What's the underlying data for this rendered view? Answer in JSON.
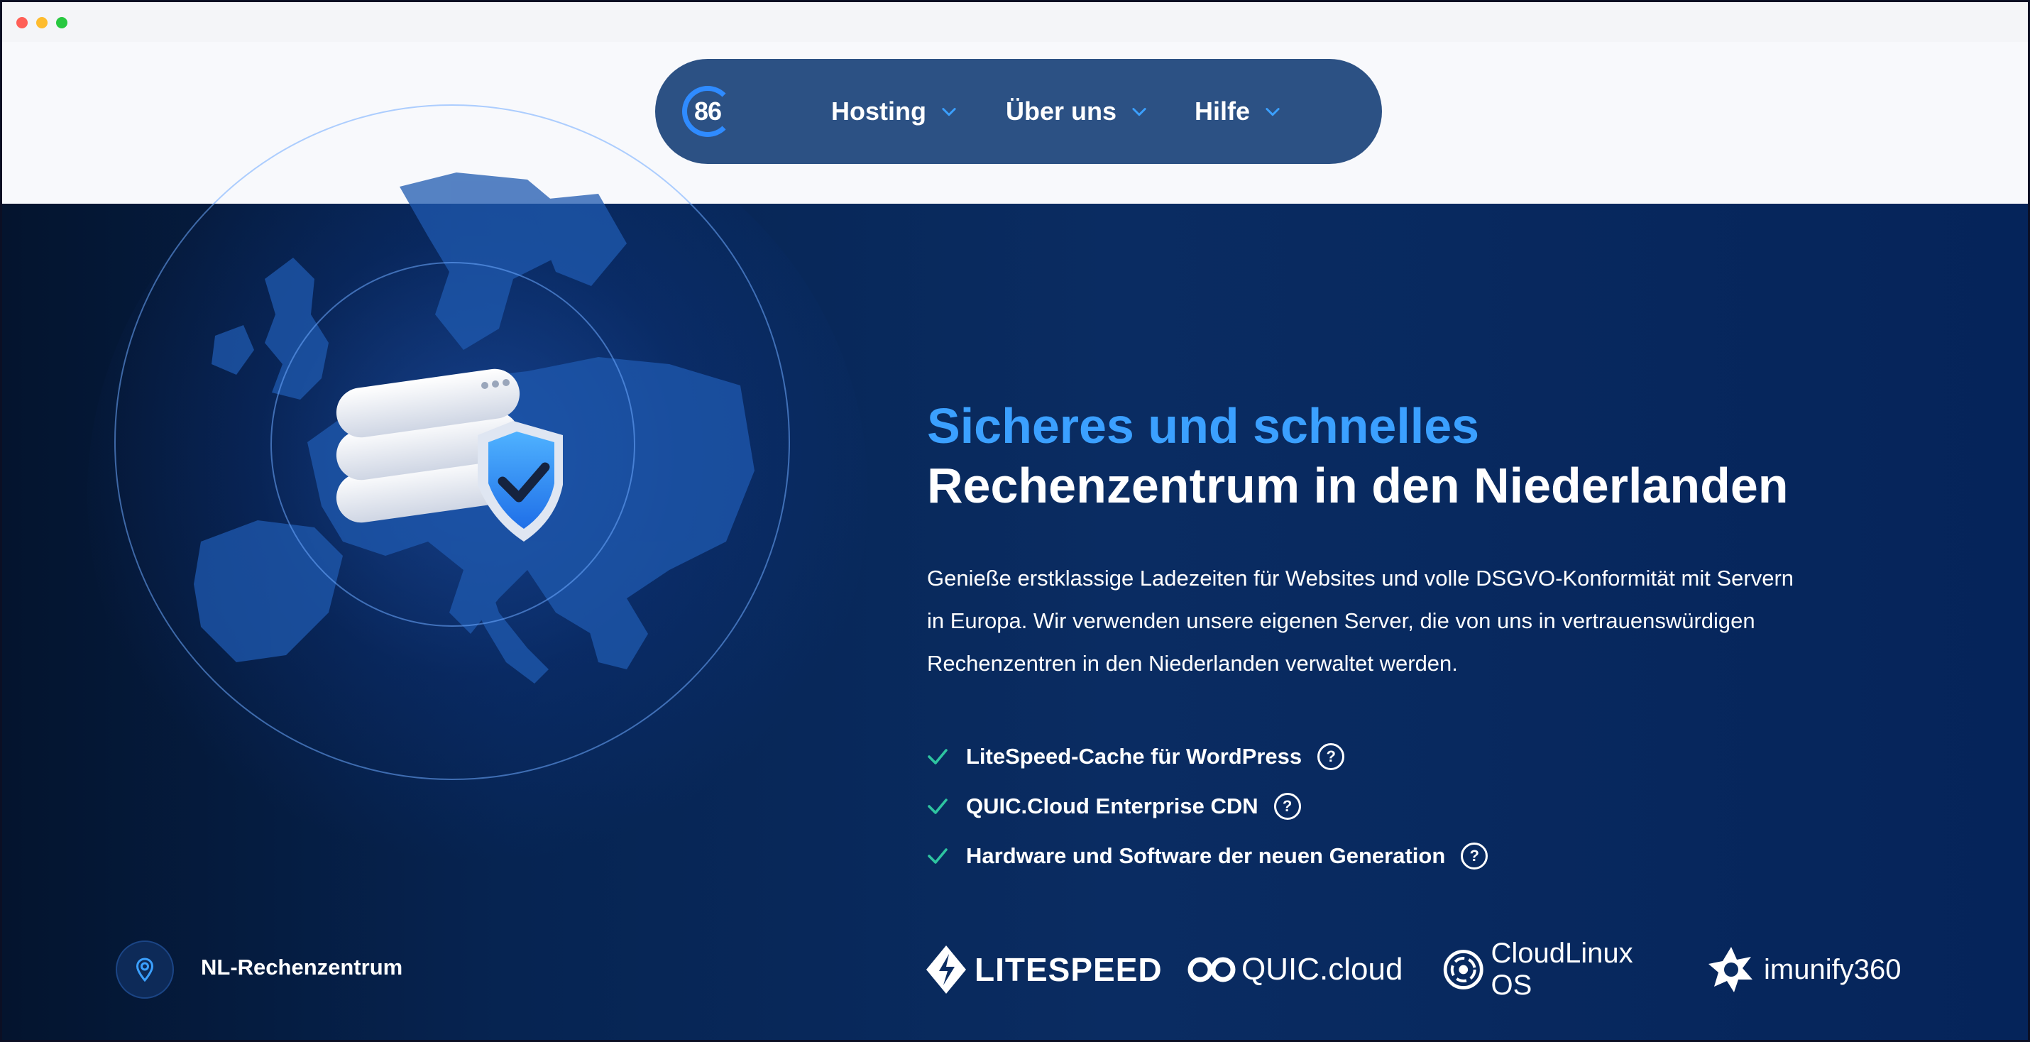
{
  "nav": {
    "logo_text": "86",
    "items": [
      {
        "label": "Hosting"
      },
      {
        "label": "Über uns"
      },
      {
        "label": "Hilfe"
      }
    ]
  },
  "hero": {
    "headline_line1": "Sicheres und schnelles",
    "headline_line2": "Rechenzentrum in den Niederlanden",
    "description_lines": [
      "Genieße erstklassige Ladezeiten für Websites und volle DSGVO-Konformität mit Servern",
      "in Europa. Wir verwenden unsere eigenen Server, die von uns in vertrauenswürdigen",
      "Rechenzentren in den Niederlanden verwaltet werden."
    ],
    "features": [
      {
        "label": "LiteSpeed-Cache für WordPress",
        "help": "?"
      },
      {
        "label": "QUIC.Cloud Enterprise CDN",
        "help": "?"
      },
      {
        "label": "Hardware und Software der neuen Generation",
        "help": "?"
      }
    ],
    "datacenter_label": "NL-Rechenzentrum",
    "partners": [
      {
        "name": "LITESPEED",
        "icon": "litespeed-logo-icon"
      },
      {
        "name": "QUIC.cloud",
        "icon": "quic-cloud-logo-icon"
      },
      {
        "name": "CloudLinux OS",
        "icon": "cloudlinux-logo-icon"
      },
      {
        "name": "imunify360",
        "icon": "imunify360-logo-icon"
      }
    ]
  },
  "colors": {
    "accent_blue": "#3ba0ff",
    "check_green": "#2ec4a0",
    "hero_bg": "#062452",
    "nav_bg": "#2c5184"
  }
}
